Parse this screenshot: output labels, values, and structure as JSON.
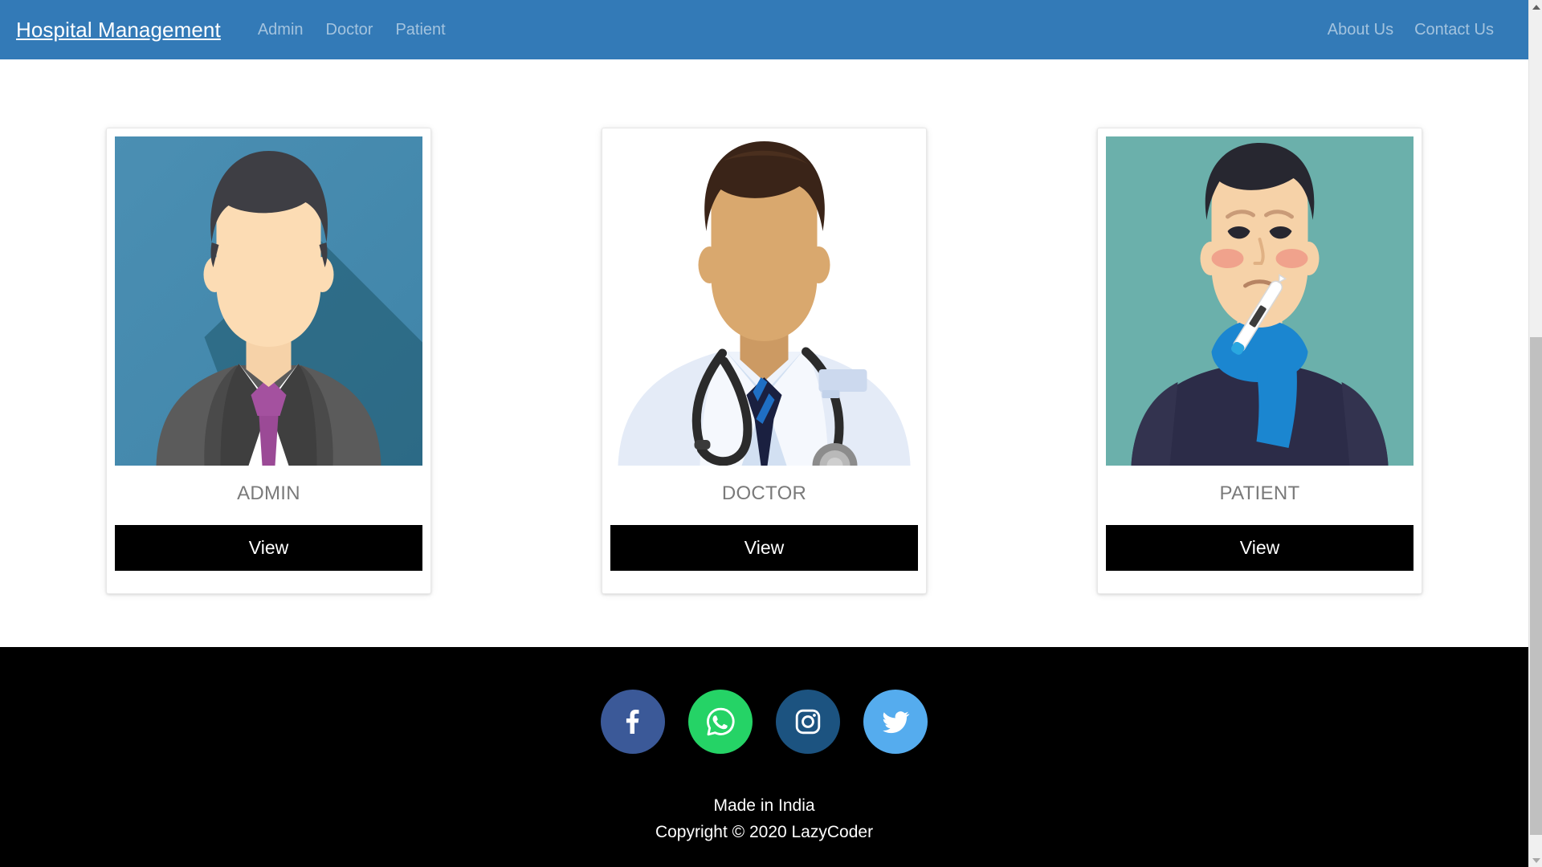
{
  "navbar": {
    "brand": "Hospital Management",
    "left_links": [
      {
        "label": "Admin"
      },
      {
        "label": "Doctor"
      },
      {
        "label": "Patient"
      }
    ],
    "right_links": [
      {
        "label": "About Us"
      },
      {
        "label": "Contact Us"
      }
    ],
    "background_color": "#337ab7",
    "brand_color": "#ffffff",
    "link_color": "rgba(255,255,255,0.55)"
  },
  "main": {
    "cards": [
      {
        "label": "ADMIN",
        "button_label": "View",
        "image_name": "admin-avatar-illustration",
        "image_bg_color": "#4a8db0"
      },
      {
        "label": "DOCTOR",
        "button_label": "View",
        "image_name": "doctor-avatar-illustration",
        "image_bg_color": "#ffffff"
      },
      {
        "label": "PATIENT",
        "button_label": "View",
        "image_name": "patient-avatar-illustration",
        "image_bg_color": "#6bb0ab"
      }
    ],
    "label_color": "#7a7a7a",
    "button_color": "#000000"
  },
  "footer": {
    "background_color": "#000000",
    "socials": [
      {
        "name": "facebook",
        "color": "#3b5998"
      },
      {
        "name": "whatsapp",
        "color": "#25d366"
      },
      {
        "name": "instagram",
        "color": "#1c5380"
      },
      {
        "name": "twitter",
        "color": "#55acee"
      }
    ],
    "line1": "Made in India",
    "line2": "Copyright © 2020 LazyCoder",
    "text_color": "#ffffff"
  },
  "scrollbar": {
    "track_color": "#f0f0f0",
    "thumb_color": "#c0c0c0"
  }
}
